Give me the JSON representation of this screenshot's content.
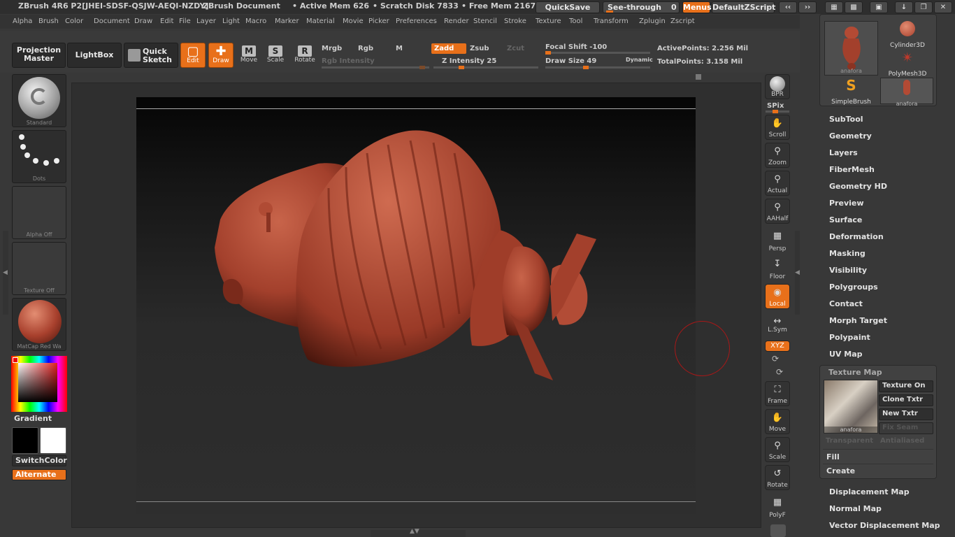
{
  "title": {
    "app": "ZBrush 4R6  P2[JHEI-SDSF-QSJW-AEQI-NZDY]",
    "document": "ZBrush Document",
    "active_mem": "• Active Mem 626",
    "scratch_disk": "• Scratch Disk 7833",
    "free_mem": "• Free Mem 2167",
    "quicksave": "QuickSave",
    "see_through": "See-through",
    "see_through_value": "0",
    "menus": "Menus",
    "script": "DefaultZScript"
  },
  "menubar": [
    "Alpha",
    "Brush",
    "Color",
    "Document",
    "Draw",
    "Edit",
    "File",
    "Layer",
    "Light",
    "Macro",
    "Marker",
    "Material",
    "Movie",
    "Picker",
    "Preferences",
    "Render",
    "Stencil",
    "Stroke",
    "Texture",
    "Tool",
    "Transform",
    "Zplugin",
    "Zscript"
  ],
  "toolbar": {
    "projection_master": "Projection Master",
    "lightbox": "LightBox",
    "quick_sketch": "Quick Sketch",
    "edit": "Edit",
    "draw": "Draw",
    "move": "Move",
    "scale": "Scale",
    "rotate": "Rotate",
    "mrgb": "Mrgb",
    "rgb": "Rgb",
    "m": "M",
    "rgb_intensity": "Rgb Intensity",
    "zadd": "Zadd",
    "zsub": "Zsub",
    "zcut": "Zcut",
    "z_intensity": "Z Intensity 25",
    "focal_shift": "Focal Shift -100",
    "draw_size": "Draw Size 49",
    "dynamic": "Dynamic",
    "active_points": "ActivePoints: 2.256 Mil",
    "total_points": "TotalPoints: 3.158 Mil",
    "z_intensity_level": 0.25,
    "focal_shift_level": 0,
    "draw_size_level": 0.38
  },
  "left_shelf": {
    "brush": "Standard",
    "stroke": "Dots",
    "alpha": "Alpha  Off",
    "texture": "Texture  Off",
    "material": "MatCap  Red  Wa",
    "gradient": "Gradient",
    "switch_color": "SwitchColor",
    "alternate": "Alternate"
  },
  "right_shelf": {
    "bpr": "BPR",
    "spix": "SPix",
    "scroll": "Scroll",
    "zoom": "Zoom",
    "actual": "Actual",
    "aahalf": "AAHalf",
    "persp": "Persp",
    "floor": "Floor",
    "local": "Local",
    "lsym": "L.Sym",
    "xyz": "XYZ",
    "frame": "Frame",
    "move": "Move",
    "scale": "Scale",
    "rotate": "Rotate",
    "polyf": "PolyF"
  },
  "tool_palette": {
    "thumbs": [
      "anafora",
      "Cylinder3D",
      "PolyMesh3D",
      "SimpleBrush",
      "anafora"
    ],
    "sections": [
      "SubTool",
      "Geometry",
      "Layers",
      "FiberMesh",
      "Geometry HD",
      "Preview",
      "Surface",
      "Deformation",
      "Masking",
      "Visibility",
      "Polygroups",
      "Contact",
      "Morph Target",
      "Polypaint",
      "UV Map"
    ],
    "texture_map": {
      "title": "Texture Map",
      "thumb_label": "anafora",
      "texture_on": "Texture On",
      "clone_txtr": "Clone Txtr",
      "new_txtr": "New Txtr",
      "fix_seam": "Fix Seam",
      "transparent": "Transparent",
      "antialiased": "Antialiased",
      "fill": "Fill",
      "create": "Create"
    },
    "after_sections": [
      "Displacement Map",
      "Normal Map",
      "Vector Displacement Map"
    ]
  },
  "colors": {
    "accent": "#e8701a",
    "bg": "#383838",
    "model": "#a8402d"
  }
}
